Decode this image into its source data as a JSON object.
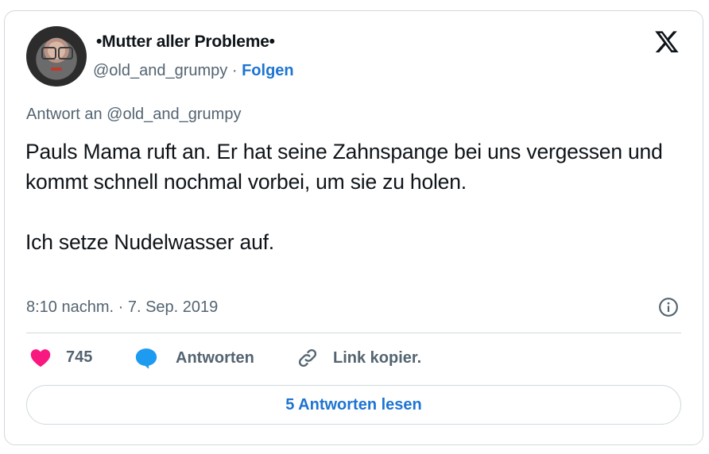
{
  "author": {
    "display_name": "•Mutter aller Probleme•",
    "handle": "@old_and_grumpy",
    "separator": "·",
    "follow_label": "Folgen"
  },
  "tweet": {
    "reply_to": "Antwort an @old_and_grumpy",
    "paragraph1": "Pauls Mama ruft an. Er hat seine Zahnspange bei uns vergessen und kommt schnell nochmal vorbei, um sie zu holen.",
    "paragraph2": "Ich setze Nudelwasser auf.",
    "timestamp": "8:10 nachm. · 7. Sep. 2019"
  },
  "actions": {
    "like_count": "745",
    "reply_label": "Antworten",
    "copy_link_label": "Link kopier."
  },
  "read_replies_label": "5 Antworten lesen",
  "icons": [
    "x-logo-icon",
    "info-icon",
    "heart-icon",
    "reply-bubble-icon",
    "link-icon"
  ],
  "colors": {
    "link_blue": "#1d74d1",
    "heart_pink": "#f91880",
    "reply_blue": "#1d9bf0",
    "muted_text": "#536471",
    "border": "#cfd9de"
  }
}
